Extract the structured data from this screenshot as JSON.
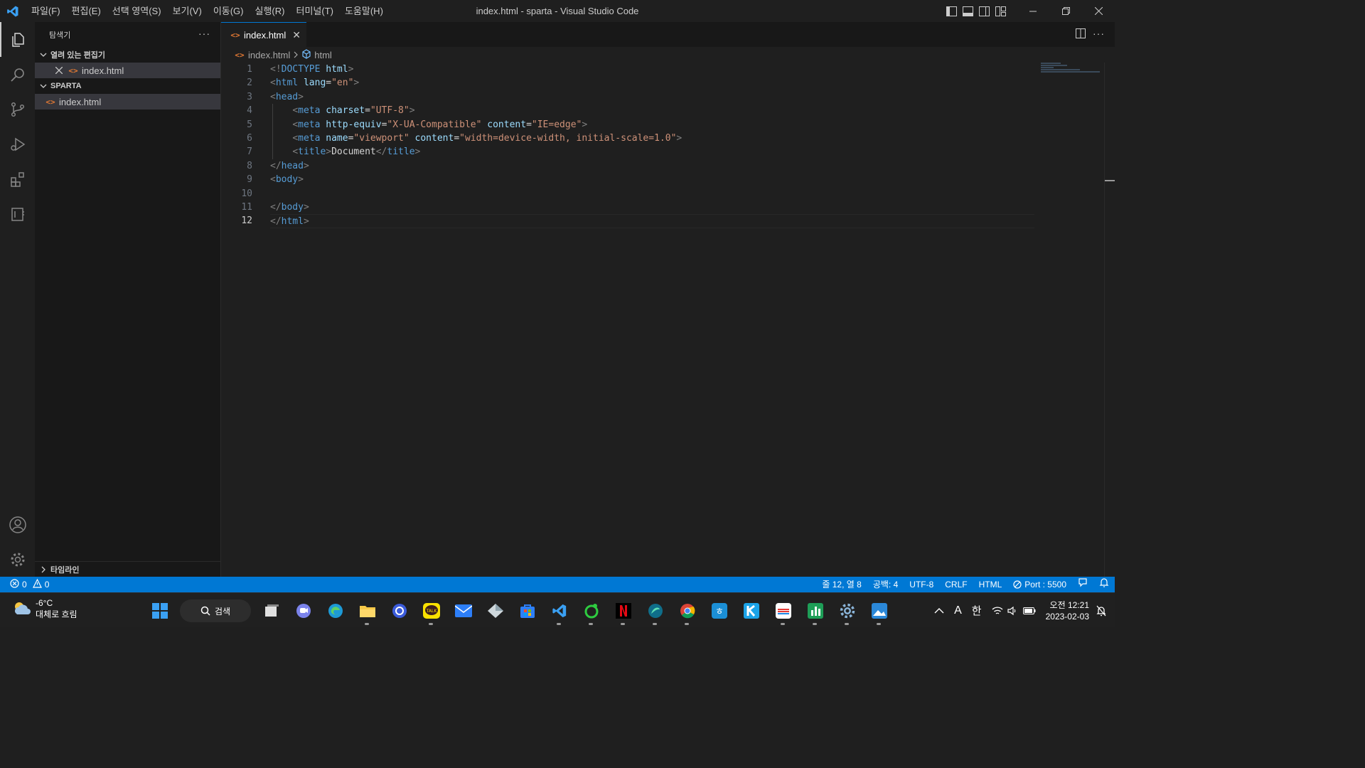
{
  "titlebar": {
    "menu": [
      "파일(F)",
      "편집(E)",
      "선택 영역(S)",
      "보기(V)",
      "이동(G)",
      "실행(R)",
      "터미널(T)",
      "도움말(H)"
    ],
    "window_title": "index.html - sparta - Visual Studio Code"
  },
  "sidebar": {
    "header": "탐색기",
    "open_editors_title": "열려 있는 편집기",
    "open_editors": [
      {
        "name": "index.html"
      }
    ],
    "folder_title": "SPARTA",
    "files": [
      {
        "name": "index.html"
      }
    ],
    "timeline_title": "타임라인"
  },
  "tabs": [
    {
      "label": "index.html"
    }
  ],
  "breadcrumb": {
    "file": "index.html",
    "symbol": "html"
  },
  "editor": {
    "line_numbers": [
      "1",
      "2",
      "3",
      "4",
      "5",
      "6",
      "7",
      "8",
      "9",
      "10",
      "11",
      "12"
    ],
    "current_line": 12,
    "lines": [
      "<!DOCTYPE html>",
      "<html lang=\"en\">",
      "<head>",
      "    <meta charset=\"UTF-8\">",
      "    <meta http-equiv=\"X-UA-Compatible\" content=\"IE=edge\">",
      "    <meta name=\"viewport\" content=\"width=device-width, initial-scale=1.0\">",
      "    <title>Document</title>",
      "</head>",
      "<body>",
      "",
      "</body>",
      "</html>"
    ]
  },
  "statusbar": {
    "errors": "0",
    "warnings": "0",
    "position": "줄 12, 열 8",
    "spaces": "공백: 4",
    "encoding": "UTF-8",
    "eol": "CRLF",
    "language": "HTML",
    "port": "Port : 5500"
  },
  "taskbar": {
    "temperature": "-6°C",
    "weather": "대체로 흐림",
    "search_label": "검색",
    "ime_mode": "A",
    "ime_lang": "한",
    "time": "오전 12:21",
    "date": "2023-02-03"
  },
  "colors": {
    "accent": "#0078d4",
    "statusbar": "#0078d4",
    "tag": "#569cd6",
    "attr": "#9cdcfe",
    "string": "#ce9178",
    "html_icon": "#e37933"
  }
}
